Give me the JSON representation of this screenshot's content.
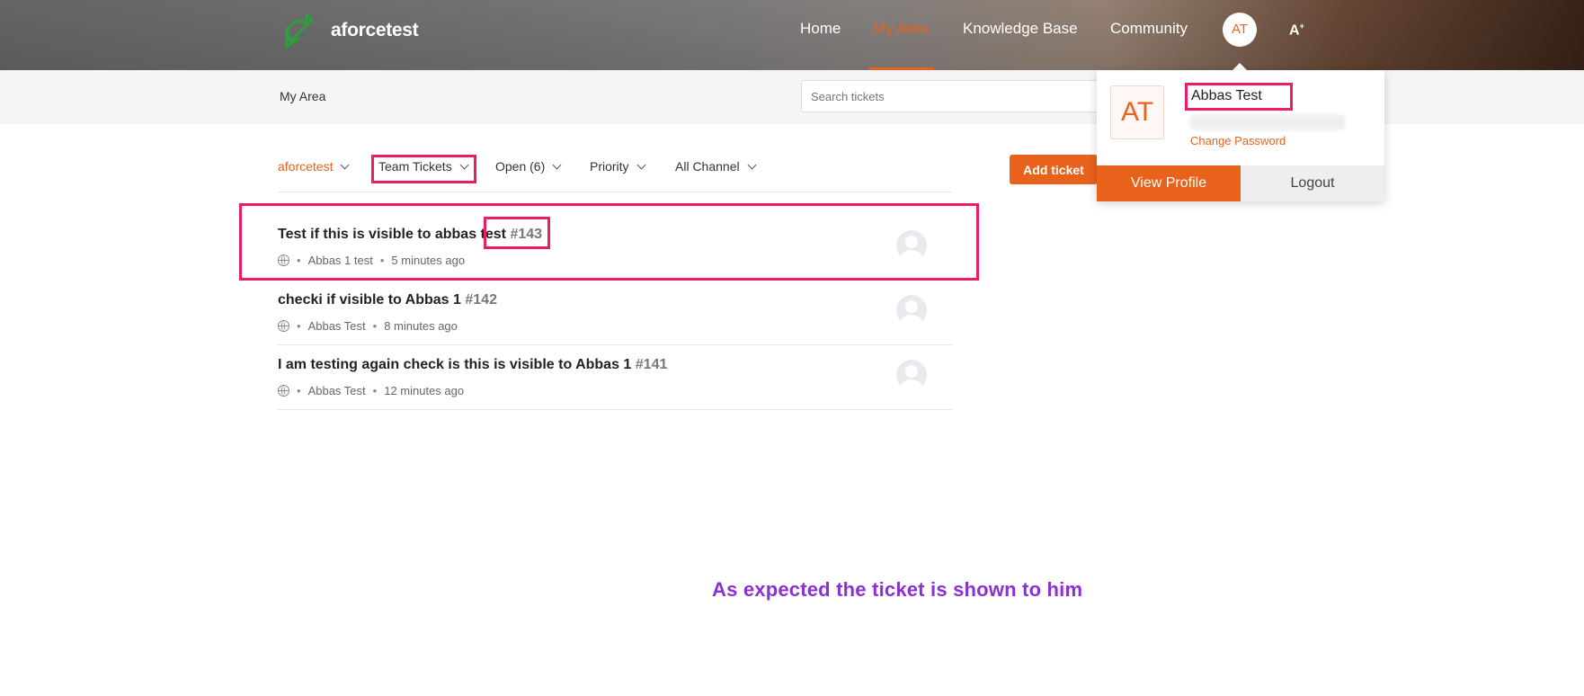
{
  "header": {
    "brand": "aforcetest",
    "nav": [
      "Home",
      "My Area",
      "Knowledge Base",
      "Community"
    ],
    "active_nav": "My Area",
    "avatar_initials": "AT",
    "a11y_label": "A",
    "a11y_sup": "+"
  },
  "subbar": {
    "breadcrumb": "My Area",
    "search_placeholder": "Search tickets"
  },
  "filters": {
    "department": "aforcetest",
    "view": "Team Tickets",
    "status": "Open (6)",
    "priority": "Priority",
    "channel": "All Channel"
  },
  "add_ticket_label": "Add ticket",
  "tickets": [
    {
      "title": "Test if this is visible to abbas test",
      "number": "#143",
      "author": "Abbas 1 test",
      "time": "5 minutes ago"
    },
    {
      "title": "checki if visible to Abbas 1",
      "number": "#142",
      "author": "Abbas Test",
      "time": "8 minutes ago"
    },
    {
      "title": "I am testing again check is this is visible to Abbas 1",
      "number": "#141",
      "author": "Abbas Test",
      "time": "12 minutes ago"
    }
  ],
  "profile_dropdown": {
    "initials": "AT",
    "name": "Abbas Test",
    "change_password": "Change Password",
    "view_profile": "View Profile",
    "logout": "Logout"
  },
  "caption": "As expected the ticket is shown to him",
  "colors": {
    "accent": "#e8621c",
    "highlight": "#ec1e61",
    "caption": "#8b2fd6"
  },
  "meta_separator": "•"
}
